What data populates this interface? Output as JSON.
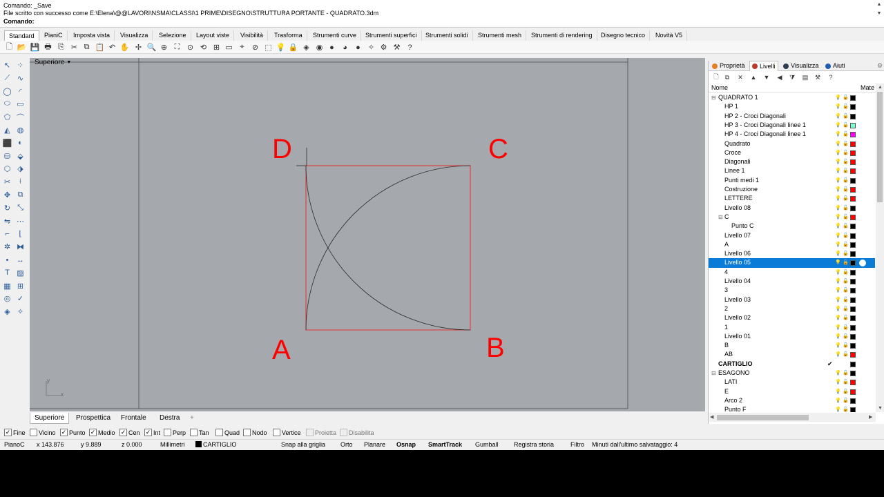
{
  "command": {
    "line1": "Comando: _Save",
    "line2": "File scritto con successo come E:\\Elena\\@@LAVORI\\NSMA\\CLASSI\\1 PRIME\\DISEGNO\\STRUTTURA PORTANTE - QUADRATO.3dm",
    "prompt": "Comando:",
    "value": ""
  },
  "toolbar_tabs": [
    "Standard",
    "PianiC",
    "Imposta vista",
    "Visualizza",
    "Selezione",
    "Layout viste",
    "Visibilità",
    "Trasforma",
    "Strumenti curve",
    "Strumenti superfici",
    "Strumenti solidi",
    "Strumenti mesh",
    "Strumenti di rendering",
    "Disegno tecnico",
    "Novità V5"
  ],
  "active_tab": "Standard",
  "viewport": {
    "title": "Superiore",
    "labels": {
      "a": "A",
      "b": "B",
      "c": "C",
      "d": "D"
    },
    "axis_x": "x",
    "axis_y": "y",
    "colors": {
      "background": "#a5a8ad",
      "square": "#e53030",
      "arc": "#2a2a2a",
      "label": "#ff0000"
    }
  },
  "viewport_tabs": [
    "Superiore",
    "Prospettica",
    "Frontale",
    "Destra"
  ],
  "panel": {
    "tabs": [
      "Proprietà",
      "Livelli",
      "Visualizza",
      "Aiuti"
    ],
    "active": "Livelli",
    "col_name": "Nome",
    "col_mat": "Mate",
    "layers": [
      {
        "name": "QUADRATO 1",
        "level": 0,
        "expander": "⊟",
        "bulb": "y",
        "color": "#000000"
      },
      {
        "name": "HP 1",
        "level": 1,
        "bulb": "b",
        "color": "#000000"
      },
      {
        "name": "HP 2 - Croci Diagonali",
        "level": 1,
        "bulb": "b",
        "color": "#000000"
      },
      {
        "name": "HP 3 - Croci Diagonali linee 1",
        "level": 1,
        "bulb": "b",
        "color": "#7fffd4"
      },
      {
        "name": "HP 4 - Croci Diagonali linee 1",
        "level": 1,
        "bulb": "b",
        "color": "#ff00ff"
      },
      {
        "name": "Quadrato",
        "level": 1,
        "bulb": "b",
        "color": "#ff0000"
      },
      {
        "name": "Croce",
        "level": 1,
        "bulb": "b",
        "color": "#ff0000"
      },
      {
        "name": "Diagonali",
        "level": 1,
        "bulb": "b",
        "color": "#ff0000"
      },
      {
        "name": "Linee 1",
        "level": 1,
        "bulb": "b",
        "color": "#ff0000"
      },
      {
        "name": "Punti medi 1",
        "level": 1,
        "bulb": "b",
        "color": "#000000"
      },
      {
        "name": "Costruzione",
        "level": 1,
        "bulb": "y",
        "color": "#ff0000"
      },
      {
        "name": "LETTERE",
        "level": 1,
        "bulb": "y",
        "color": "#ff0000"
      },
      {
        "name": "Livello 08",
        "level": 1,
        "bulb": "y",
        "color": "#000000"
      },
      {
        "name": "C",
        "level": 1,
        "expander": "⊟",
        "bulb": "y",
        "color": "#ff0000"
      },
      {
        "name": "Punto C",
        "level": 2,
        "bulb": "b",
        "color": "#000000"
      },
      {
        "name": "Livello 07",
        "level": 1,
        "bulb": "y",
        "color": "#000000"
      },
      {
        "name": "A",
        "level": 1,
        "bulb": "b",
        "color": "#000000"
      },
      {
        "name": "Livello 06",
        "level": 1,
        "bulb": "y",
        "color": "#000000"
      },
      {
        "name": "Livello 05",
        "level": 1,
        "bulb": "y",
        "color": "#000000",
        "selected": true
      },
      {
        "name": "4",
        "level": 1,
        "bulb": "b",
        "color": "#000000"
      },
      {
        "name": "Livello 04",
        "level": 1,
        "bulb": "b",
        "color": "#000000"
      },
      {
        "name": "3",
        "level": 1,
        "bulb": "b",
        "color": "#000000"
      },
      {
        "name": "Livello 03",
        "level": 1,
        "bulb": "b",
        "color": "#000000"
      },
      {
        "name": "2",
        "level": 1,
        "bulb": "b",
        "color": "#000000"
      },
      {
        "name": "Livello 02",
        "level": 1,
        "bulb": "b",
        "color": "#000000"
      },
      {
        "name": "1",
        "level": 1,
        "bulb": "b",
        "color": "#000000"
      },
      {
        "name": "Livello 01",
        "level": 1,
        "bulb": "b",
        "color": "#000000"
      },
      {
        "name": "B",
        "level": 1,
        "bulb": "b",
        "color": "#000000"
      },
      {
        "name": "AB",
        "level": 1,
        "bulb": "y",
        "color": "#ff0000"
      },
      {
        "name": "CARTIGLIO",
        "level": 0,
        "bold": true,
        "current": "✔",
        "color": "#000000"
      },
      {
        "name": "ESAGONO",
        "level": 0,
        "expander": "⊟",
        "bulb": "y",
        "color": "#000000"
      },
      {
        "name": "LATI",
        "level": 1,
        "bulb": "y",
        "color": "#ff0000"
      },
      {
        "name": "E",
        "level": 1,
        "bulb": "y",
        "color": "#ff0000"
      },
      {
        "name": "Arco 2",
        "level": 1,
        "bulb": "y",
        "color": "#000000"
      },
      {
        "name": "Punto F",
        "level": 1,
        "bulb": "y",
        "color": "#000000"
      }
    ]
  },
  "osnaps": [
    {
      "label": "Fine",
      "checked": true
    },
    {
      "label": "Vicino",
      "checked": false
    },
    {
      "label": "Punto",
      "checked": true
    },
    {
      "label": "Medio",
      "checked": true
    },
    {
      "label": "Cen",
      "checked": true
    },
    {
      "label": "Int",
      "checked": true
    },
    {
      "label": "Perp",
      "checked": false
    },
    {
      "label": "Tan",
      "checked": false
    },
    {
      "label": "Quad",
      "checked": false
    },
    {
      "label": "Nodo",
      "checked": false
    },
    {
      "label": "Vertice",
      "checked": false
    },
    {
      "label": "Proietta",
      "checked": false,
      "disabled": true
    },
    {
      "label": "Disabilita",
      "checked": false,
      "disabled": true
    }
  ],
  "status": {
    "cplane": "PianoC",
    "x": "x 143.876",
    "y": "y 9.889",
    "z": "z 0.000",
    "units": "Millimetri",
    "layer": "CARTIGLIO",
    "snap": "Snap alla griglia",
    "orto": "Orto",
    "planare": "Planare",
    "osnap": "Osnap",
    "smarttrack": "SmartTrack",
    "gumball": "Gumball",
    "storia": "Registra storia",
    "filtro": "Filtro",
    "saved": "Minuti dall'ultimo salvataggio: 4"
  }
}
